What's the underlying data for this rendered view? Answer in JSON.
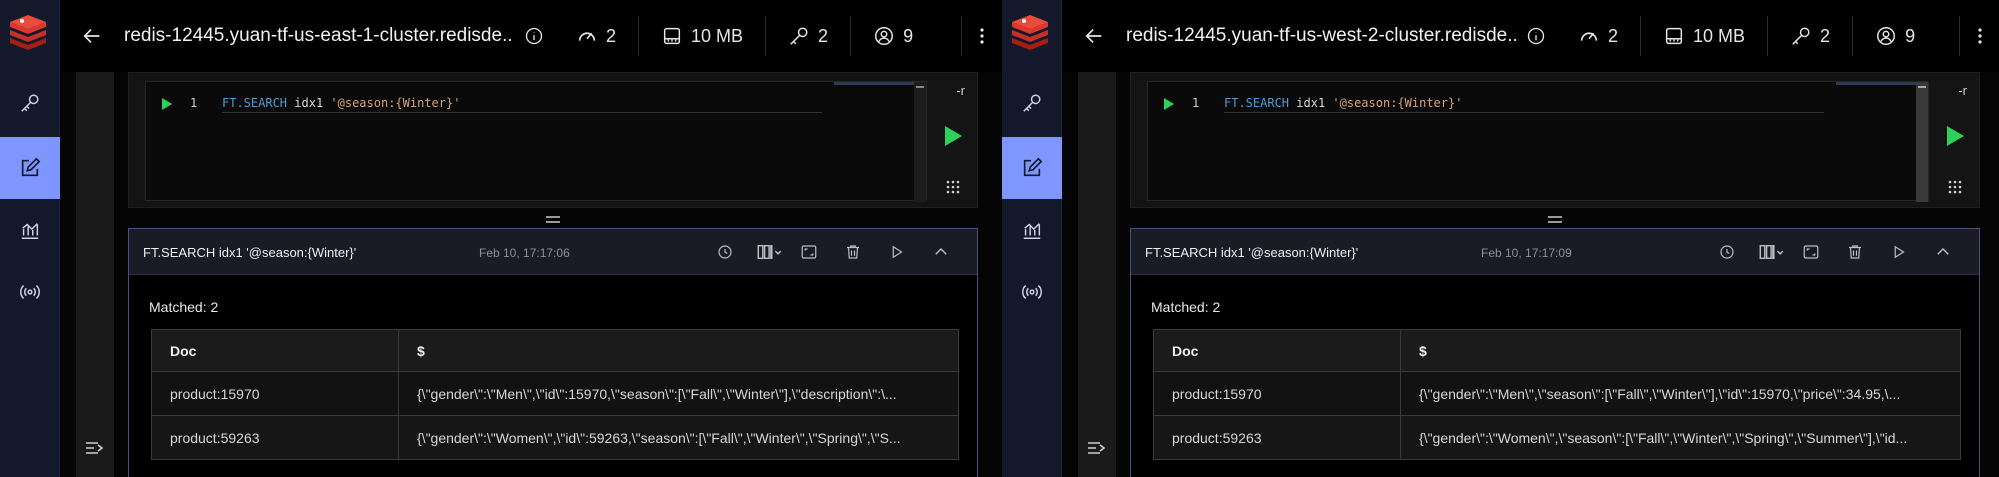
{
  "panes": [
    {
      "db_name": "redis-12445.yuan-tf-us-east-1-cluster.redisde...",
      "stats": {
        "ops": "2",
        "memory": "10 MB",
        "keys": "2",
        "clients": "9"
      },
      "editor": {
        "line_number": "1",
        "cmd": "FT.SEARCH",
        "index": "idx1",
        "arg": "'@season:{Winter}'",
        "flag": "-r"
      },
      "result": {
        "query": "FT.SEARCH idx1 '@season:{Winter}'",
        "timestamp": "Feb 10, 17:17:06",
        "matched": "Matched: 2",
        "columns": [
          "Doc",
          "$"
        ],
        "rows": [
          [
            "product:15970",
            "{\\\"gender\\\":\\\"Men\\\",\\\"id\\\":15970,\\\"season\\\":[\\\"Fall\\\",\\\"Winter\\\"],\\\"description\\\":\\..."
          ],
          [
            "product:59263",
            "{\\\"gender\\\":\\\"Women\\\",\\\"id\\\":59263,\\\"season\\\":[\\\"Fall\\\",\\\"Winter\\\",\\\"Spring\\\",\\\"S..."
          ]
        ]
      }
    },
    {
      "db_name": "redis-12445.yuan-tf-us-west-2-cluster.redisde...",
      "stats": {
        "ops": "2",
        "memory": "10 MB",
        "keys": "2",
        "clients": "9"
      },
      "editor": {
        "line_number": "1",
        "cmd": "FT.SEARCH",
        "index": "idx1",
        "arg": "'@season:{Winter}'",
        "flag": "-r"
      },
      "result": {
        "query": "FT.SEARCH idx1 '@season:{Winter}'",
        "timestamp": "Feb 10, 17:17:09",
        "matched": "Matched: 2",
        "columns": [
          "Doc",
          "$"
        ],
        "rows": [
          [
            "product:15970",
            "{\\\"gender\\\":\\\"Men\\\",\\\"season\\\":[\\\"Fall\\\",\\\"Winter\\\"],\\\"id\\\":15970,\\\"price\\\":34.95,\\..."
          ],
          [
            "product:59263",
            "{\\\"gender\\\":\\\"Women\\\",\\\"season\\\":[\\\"Fall\\\",\\\"Winter\\\",\\\"Spring\\\",\\\"Summer\\\"],\\\"id..."
          ]
        ]
      }
    }
  ],
  "icons": {
    "nav": [
      "key-icon",
      "workbench-icon",
      "analytics-icon",
      "pubsub-icon"
    ],
    "stats": [
      "gauge-icon",
      "memory-icon",
      "key-icon",
      "users-icon"
    ]
  },
  "colors": {
    "accent": "#7f96ff",
    "run_green": "#2fd05a",
    "rail": "#14182b",
    "keyword": "#4f9bd4",
    "string": "#d9a173"
  }
}
